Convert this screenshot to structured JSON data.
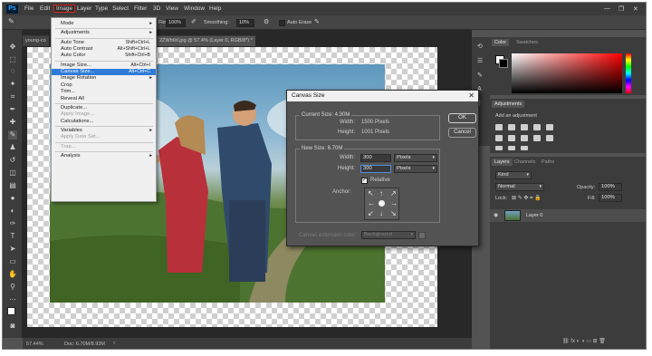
{
  "menubar": {
    "logo": "Ps",
    "items": [
      "File",
      "Edit",
      "Image",
      "Layer",
      "Type",
      "Select",
      "Filter",
      "3D",
      "View",
      "Window",
      "Help"
    ],
    "active_item": "Image"
  },
  "options_bar": {
    "flow_label": "Flow:",
    "flow_value": "100%",
    "smoothing_label": "Smoothing:",
    "smoothing_value": "10%",
    "auto_erase_label": "Auto Erase",
    "angle_value": "0°"
  },
  "document": {
    "tab_left": "young-co",
    "tab_right": "2ZWhtIrl.jpg @ 57.4% (Layer 0, RGB/8*) *",
    "zoom": "57.44%",
    "doc_info": "Doc: 6.70M/8.93M"
  },
  "image_menu": {
    "items": [
      {
        "label": "Mode",
        "shortcut": "",
        "submenu": true,
        "disabled": false
      },
      {
        "sep": true
      },
      {
        "label": "Adjustments",
        "shortcut": "",
        "submenu": true,
        "disabled": false
      },
      {
        "sep": true
      },
      {
        "label": "Auto Tone",
        "shortcut": "Shift+Ctrl+L",
        "submenu": false,
        "disabled": false
      },
      {
        "label": "Auto Contrast",
        "shortcut": "Alt+Shift+Ctrl+L",
        "submenu": false,
        "disabled": false
      },
      {
        "label": "Auto Color",
        "shortcut": "Shift+Ctrl+B",
        "submenu": false,
        "disabled": false
      },
      {
        "sep": true
      },
      {
        "label": "Image Size...",
        "shortcut": "Alt+Ctrl+I",
        "submenu": false,
        "disabled": false
      },
      {
        "label": "Canvas Size...",
        "shortcut": "Alt+Ctrl+C",
        "submenu": false,
        "disabled": false,
        "highlight": true
      },
      {
        "label": "Image Rotation",
        "shortcut": "",
        "submenu": true,
        "disabled": false
      },
      {
        "label": "Crop",
        "shortcut": "",
        "submenu": false,
        "disabled": false
      },
      {
        "label": "Trim...",
        "shortcut": "",
        "submenu": false,
        "disabled": false
      },
      {
        "label": "Reveal All",
        "shortcut": "",
        "submenu": false,
        "disabled": false
      },
      {
        "sep": true
      },
      {
        "label": "Duplicate...",
        "shortcut": "",
        "submenu": false,
        "disabled": false
      },
      {
        "label": "Apply Image...",
        "shortcut": "",
        "submenu": false,
        "disabled": true
      },
      {
        "label": "Calculations...",
        "shortcut": "",
        "submenu": false,
        "disabled": false
      },
      {
        "sep": true
      },
      {
        "label": "Variables",
        "shortcut": "",
        "submenu": true,
        "disabled": false
      },
      {
        "label": "Apply Data Set...",
        "shortcut": "",
        "submenu": false,
        "disabled": true
      },
      {
        "sep": true
      },
      {
        "label": "Trap...",
        "shortcut": "",
        "submenu": false,
        "disabled": true
      },
      {
        "sep": true
      },
      {
        "label": "Analysis",
        "shortcut": "",
        "submenu": true,
        "disabled": false
      }
    ]
  },
  "dialog": {
    "title": "Canvas Size",
    "current_size_label": "Current Size: 4.30M",
    "width_label": "Width:",
    "current_width": "1500 Pixels",
    "height_label": "Height:",
    "current_height": "1001 Pixels",
    "new_size_label": "New Size: 6.70M",
    "new_width_label": "Width:",
    "new_width_value": "300",
    "new_height_label": "Height:",
    "new_height_value": "300",
    "unit_width": "Pixels",
    "unit_height": "Pixels",
    "relative_label": "Relative",
    "relative_checked": true,
    "anchor_label": "Anchor:",
    "extension_label": "Canvas extension color:",
    "extension_value": "Background",
    "ok_label": "OK",
    "cancel_label": "Cancel"
  },
  "panels": {
    "color_tabs": [
      "Color",
      "Swatches"
    ],
    "adjustments_tab": "Adjustments",
    "adjustments_hint": "Add an adjustment",
    "layers_tabs": [
      "Layers",
      "Channels",
      "Paths"
    ],
    "kind_label": "Kind",
    "blend_mode": "Normal",
    "opacity_label": "Opacity:",
    "opacity_value": "100%",
    "lock_label": "Lock:",
    "fill_label": "Fill:",
    "fill_value": "100%",
    "layer_name": "Layer 0"
  },
  "colors": {
    "accent": "#2f7bd8",
    "menu_highlight_border": "#d8231f"
  }
}
